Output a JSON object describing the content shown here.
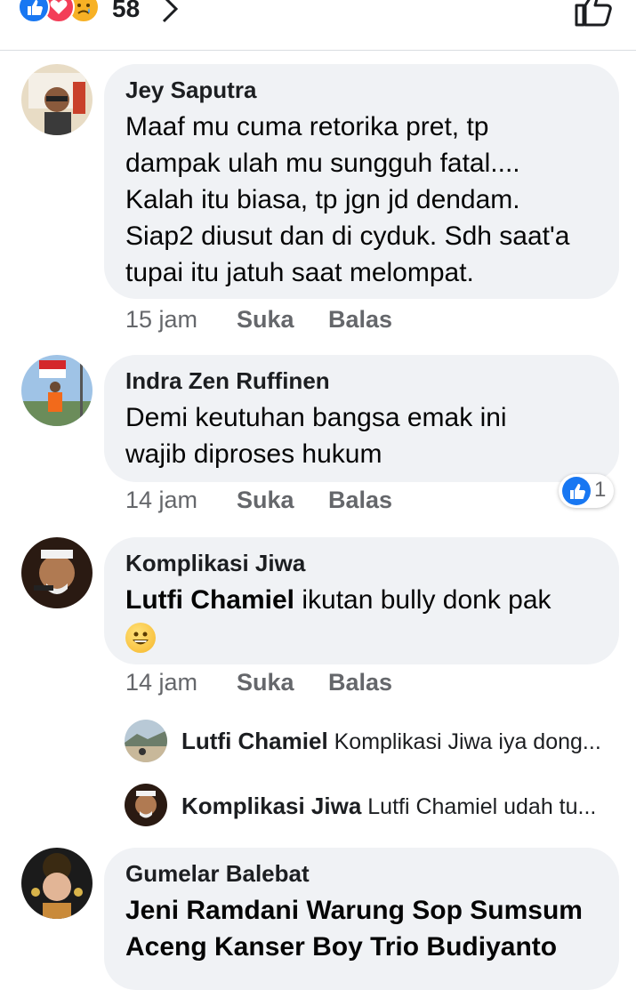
{
  "header": {
    "reaction_count": "58",
    "reactions": [
      "like-icon",
      "love-icon",
      "sad-icon"
    ]
  },
  "comments": [
    {
      "author": "Jey Saputra",
      "text": "Maaf mu cuma retorika pret, tp\ndampak ulah mu sungguh fatal....\nKalah itu biasa, tp jgn jd dendam.\nSiap2 diusut dan di cyduk. Sdh saat'a\ntupai itu jatuh saat melompat.",
      "time": "15 jam",
      "like_label": "Suka",
      "reply_label": "Balas"
    },
    {
      "author": "Indra Zen Ruffinen",
      "text": "Demi keutuhan bangsa emak ini\nwajib diproses hukum",
      "time": "14 jam",
      "like_label": "Suka",
      "reply_label": "Balas",
      "reaction_count": "1"
    },
    {
      "author": "Komplikasi Jiwa",
      "mention": "Lutfi Chamiel",
      "text": " ikutan bully donk pak",
      "emoji": "grinning-face-emoji",
      "time": "14 jam",
      "like_label": "Suka",
      "reply_label": "Balas",
      "replies": [
        {
          "author": "Lutfi Chamiel",
          "text": "Komplikasi Jiwa iya dong..."
        },
        {
          "author": "Komplikasi Jiwa",
          "text": "Lutfi Chamiel udah tu..."
        }
      ]
    },
    {
      "author": "Gumelar Balebat",
      "text": "Jeni Ramdani Warung Sop Sumsum\nAceng Kanser Boy Trio Budiyanto"
    }
  ],
  "colors": {
    "bubble": "#f0f2f5",
    "meta_text": "#65676b",
    "like_blue": "#1877f2",
    "love_red": "#f33e58",
    "sad_yellow": "#f7b125"
  }
}
